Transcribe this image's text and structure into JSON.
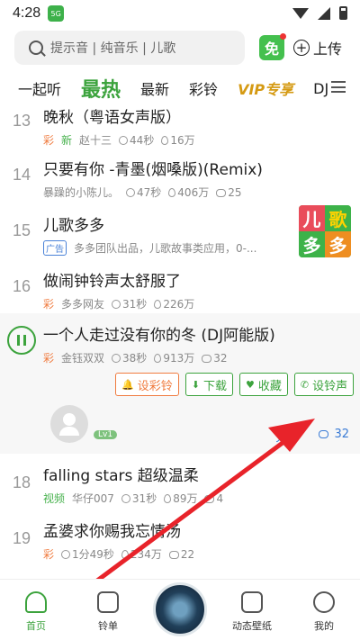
{
  "status": {
    "time": "4:28",
    "app_icon_label": "5G"
  },
  "search": {
    "placeholder": "提示音 | 纯音乐 | 儿歌",
    "mian_label": "免",
    "upload_label": "上传"
  },
  "tabs": [
    "一起听",
    "最热",
    "最新",
    "彩铃",
    "VIP专享",
    "DJ"
  ],
  "active_tab": "最热",
  "songs": [
    {
      "num": "13",
      "title": "晚秋（粤语女声版）",
      "tag": "彩",
      "tag2": "新",
      "artist": "赵十三",
      "duration": "44秒",
      "plays": "16万"
    },
    {
      "num": "14",
      "title": "只要有你 -青墨(烟嗓版)(Remix)",
      "artist": "暴躁的小陈儿。",
      "duration": "47秒",
      "plays": "406万",
      "comments": "25"
    },
    {
      "num": "15",
      "title": "儿歌多多",
      "tag": "广告",
      "artist": "多多团队出品，儿歌故事类应用，0-...",
      "ad_image_text": [
        "儿",
        "歌",
        "多",
        "多"
      ]
    },
    {
      "num": "16",
      "title": "做闹钟铃声太舒服了",
      "tag": "彩",
      "artist": "多多网友",
      "duration": "31秒",
      "plays": "226万"
    },
    {
      "num": "",
      "title": "一个人走过没有你的冬 (DJ阿能版)",
      "tag": "彩",
      "artist": "金钰双双",
      "duration": "38秒",
      "plays": "913万",
      "comments": "32"
    },
    {
      "num": "18",
      "title": "falling stars 超级温柔",
      "tag": "视频",
      "artist": "华仔007",
      "duration": "31秒",
      "plays": "89万",
      "comments": "4"
    },
    {
      "num": "19",
      "title": "孟婆求你赐我忘情汤",
      "tag": "彩",
      "artist": "",
      "duration": "1分49秒",
      "plays": "234万",
      "comments": "22"
    }
  ],
  "expanded": {
    "actions": [
      "设彩铃",
      "下载",
      "收藏",
      "设铃声"
    ],
    "level": "Lv1",
    "share_label": "分享",
    "comment_count": "32"
  },
  "nav": [
    "首页",
    "铃单",
    "",
    "动态壁纸",
    "我的"
  ],
  "colors": {
    "accent": "#3ca33d",
    "vip": "#d59a13",
    "cai_tag": "#f07c40",
    "arrow": "#e8232a"
  }
}
